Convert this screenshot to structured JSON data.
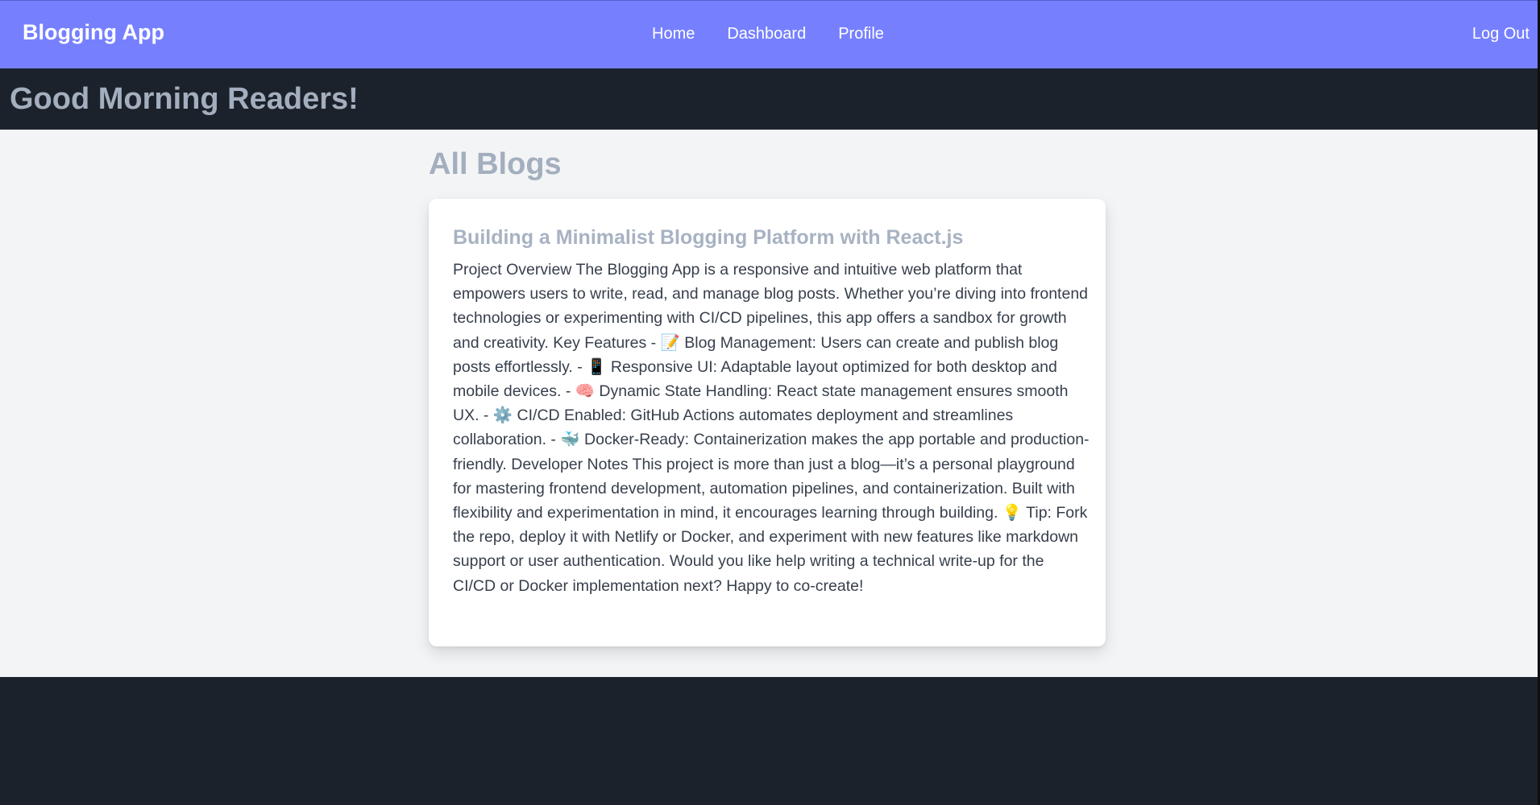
{
  "navbar": {
    "brand": "Blogging App",
    "links": [
      "Home",
      "Dashboard",
      "Profile"
    ],
    "logout": "Log Out",
    "color": "#7680ff"
  },
  "greeting": "Good Morning Readers!",
  "main": {
    "heading": "All Blogs",
    "posts": [
      {
        "title": "Building a Minimalist Blogging Platform with React.js",
        "body": "Project Overview The Blogging App is a responsive and intuitive web platform that empowers users to write, read, and manage blog posts. Whether you’re diving into frontend technologies or experimenting with CI/CD pipelines, this app offers a sandbox for growth and creativity. Key Features - 📝 Blog Management: Users can create and publish blog posts effortlessly. - 📱 Responsive UI: Adaptable layout optimized for both desktop and mobile devices. - 🧠 Dynamic State Handling: React state management ensures smooth UX. - ⚙️ CI/CD Enabled: GitHub Actions automates deployment and streamlines collaboration. - 🐳 Docker-Ready: Containerization makes the app portable and production-friendly. Developer Notes This project is more than just a blog—it’s a personal playground for mastering frontend development, automation pipelines, and containerization. Built with flexibility and experimentation in mind, it encourages learning through building. 💡 Tip: Fork the repo, deploy it with Netlify or Docker, and experiment with new features like markdown support or user authentication. Would you like help writing a technical write-up for the CI/CD or Docker implementation next? Happy to co-create!"
      }
    ]
  }
}
